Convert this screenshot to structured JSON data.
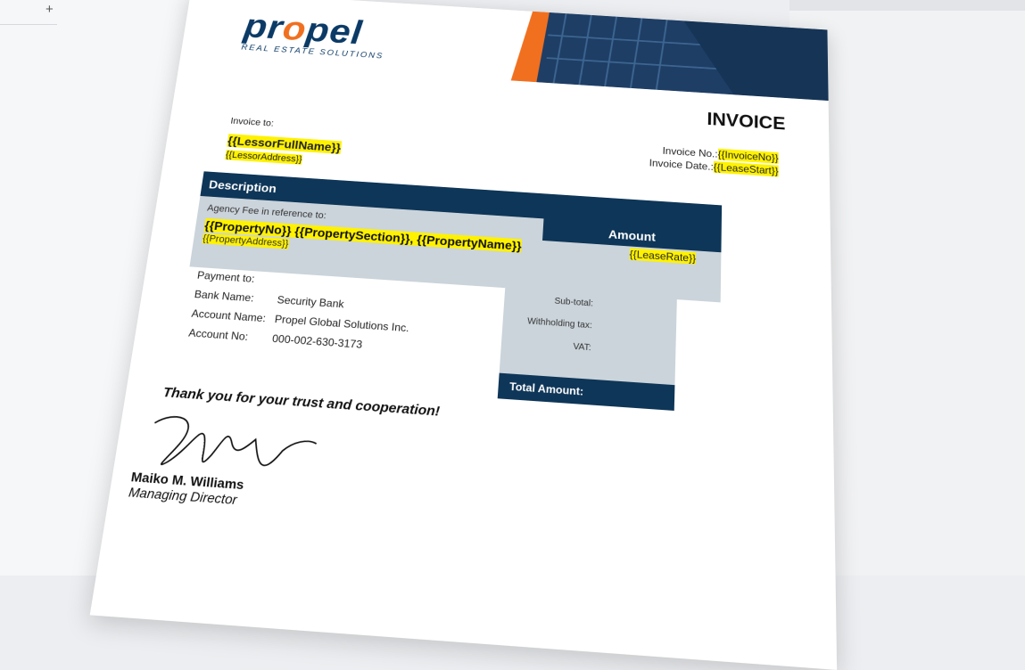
{
  "sidebar": {
    "add_label": "+"
  },
  "brand": {
    "name_pre": "pr",
    "name_o": "o",
    "name_post": "pel",
    "tagline": "REAL ESTATE SOLUTIONS",
    "navy": "#0b3a66",
    "orange": "#f07020"
  },
  "invoice": {
    "title": "INVOICE",
    "number_label": "Invoice No.:",
    "number_value": "{{InvoiceNo}}",
    "date_label": "Invoice Date.:",
    "date_value": "{{LeaseStart}}"
  },
  "bill_to": {
    "label": "Invoice to:",
    "name": "{{LessorFullName}}",
    "address": "{{LessorAddress}}"
  },
  "table": {
    "desc_header": "Description",
    "amount_header": "Amount",
    "ref_text": "Agency Fee in reference to:",
    "property_line": "{{PropertyNo}} {{PropertySection}}, {{PropertyName}}",
    "property_address": "{{PropertyAddress}}",
    "rate": "{{LeaseRate}}"
  },
  "totals": {
    "subtotal": "Sub-total:",
    "withholding": "Withholding tax:",
    "vat": "VAT:",
    "total": "Total Amount:"
  },
  "payment": {
    "label": "Payment to:",
    "bank_k": "Bank Name:",
    "bank_v": "Security Bank",
    "acct_name_k": "Account Name:",
    "acct_name_v": "Propel Global Solutions Inc.",
    "acct_no_k": "Account No:",
    "acct_no_v": "000-002-630-3173"
  },
  "closing": {
    "thanks": "Thank you for your trust and cooperation!",
    "signer_name": "Maiko M. Williams",
    "signer_role": "Managing Director"
  }
}
